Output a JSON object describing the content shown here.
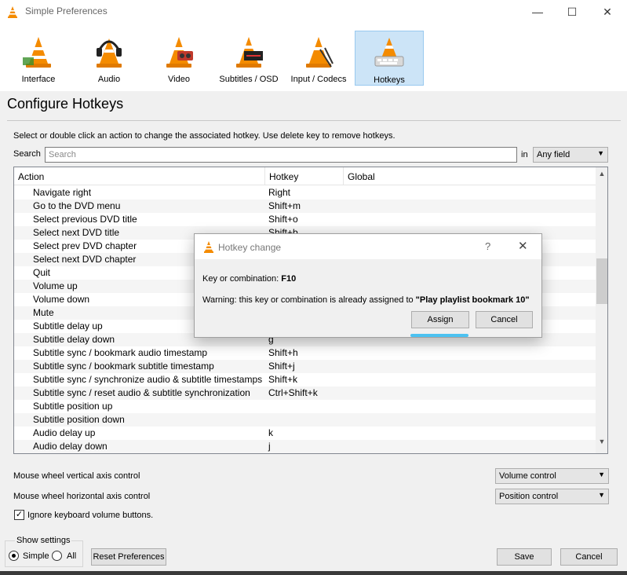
{
  "window": {
    "title": "Simple Preferences",
    "minimize_glyph": "—",
    "maximize_glyph": "☐",
    "close_glyph": "✕"
  },
  "toolbar": {
    "items": [
      {
        "label": "Interface",
        "icon": "interface-cone-icon"
      },
      {
        "label": "Audio",
        "icon": "audio-headphones-cone-icon"
      },
      {
        "label": "Video",
        "icon": "video-cone-icon"
      },
      {
        "label": "Subtitles / OSD",
        "icon": "subtitles-cone-icon"
      },
      {
        "label": "Input / Codecs",
        "icon": "input-codecs-cone-icon"
      },
      {
        "label": "Hotkeys",
        "icon": "hotkeys-cone-icon",
        "active": true
      }
    ]
  },
  "page_title": "Configure Hotkeys",
  "instructions": "Select or double click an action to change the associated hotkey. Use delete key to remove hotkeys.",
  "search": {
    "label": "Search",
    "placeholder": "Search",
    "value": "",
    "in_label": "in",
    "field_selected": "Any field"
  },
  "table": {
    "headers": [
      "Action",
      "Hotkey",
      "Global"
    ],
    "rows": [
      {
        "action": "Navigate right",
        "hotkey": "Right"
      },
      {
        "action": "Go to the DVD menu",
        "hotkey": "Shift+m"
      },
      {
        "action": "Select previous DVD title",
        "hotkey": "Shift+o"
      },
      {
        "action": "Select next DVD title",
        "hotkey": "Shift+b"
      },
      {
        "action": "Select prev DVD chapter",
        "hotkey": ""
      },
      {
        "action": "Select next DVD chapter",
        "hotkey": ""
      },
      {
        "action": "Quit",
        "hotkey": ""
      },
      {
        "action": "Volume up",
        "hotkey": ""
      },
      {
        "action": "Volume down",
        "hotkey": ""
      },
      {
        "action": "Mute",
        "hotkey": ""
      },
      {
        "action": "Subtitle delay up",
        "hotkey": ""
      },
      {
        "action": "Subtitle delay down",
        "hotkey": "g"
      },
      {
        "action": "Subtitle sync / bookmark audio timestamp",
        "hotkey": "Shift+h"
      },
      {
        "action": "Subtitle sync / bookmark subtitle timestamp",
        "hotkey": "Shift+j"
      },
      {
        "action": "Subtitle sync / synchronize audio & subtitle timestamps",
        "hotkey": "Shift+k"
      },
      {
        "action": "Subtitle sync / reset audio & subtitle synchronization",
        "hotkey": "Ctrl+Shift+k"
      },
      {
        "action": "Subtitle position up",
        "hotkey": ""
      },
      {
        "action": "Subtitle position down",
        "hotkey": ""
      },
      {
        "action": "Audio delay up",
        "hotkey": "k"
      },
      {
        "action": "Audio delay down",
        "hotkey": "j"
      }
    ],
    "scroll_position": 0.36
  },
  "options": {
    "vertical_label": "Mouse wheel vertical axis control",
    "vertical_value": "Volume control",
    "horizontal_label": "Mouse wheel horizontal axis control",
    "horizontal_value": "Position control",
    "ignore_volume_label": "Ignore keyboard volume buttons.",
    "ignore_volume_checked": true
  },
  "footer": {
    "show_settings_label": "Show settings",
    "simple_label": "Simple",
    "all_label": "All",
    "selected": "Simple",
    "reset_label": "Reset Preferences",
    "save_label": "Save",
    "cancel_label": "Cancel"
  },
  "dialog": {
    "title": "Hotkey change",
    "help_glyph": "?",
    "close_glyph": "✕",
    "key_label": "Key or combination: ",
    "key_value": "F10",
    "warning_prefix": "Warning: this key or combination is already assigned to ",
    "warning_target": "\"Play playlist bookmark 10\"",
    "assign_label": "Assign",
    "cancel_label": "Cancel"
  },
  "colors": {
    "vlc_orange": "#f48b00",
    "active_tab_bg": "#cce4f7",
    "focus_accent": "#4cc2f1"
  }
}
